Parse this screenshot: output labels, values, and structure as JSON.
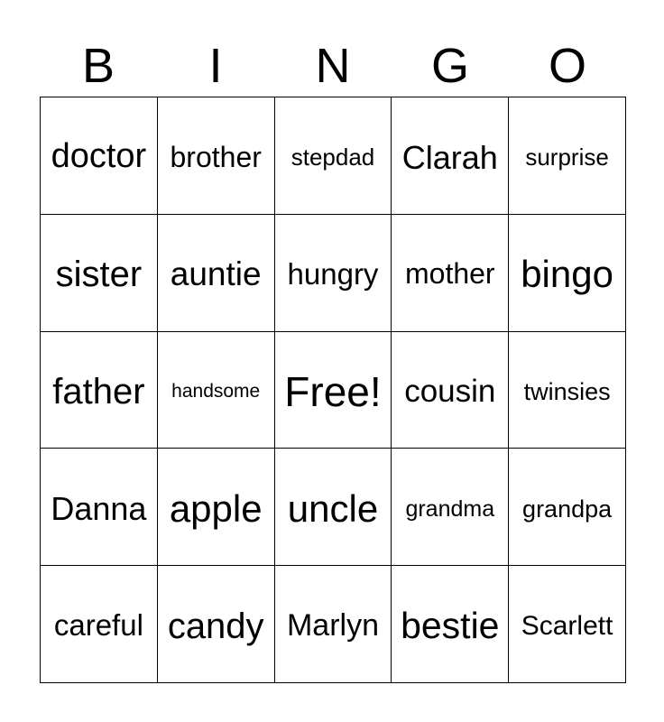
{
  "card": {
    "background_color": "#ffffff",
    "text_color": "#000000",
    "border_color": "#000000",
    "header": {
      "letters": [
        "B",
        "I",
        "N",
        "G",
        "O"
      ]
    },
    "free_space": {
      "label": "Free!",
      "row": 2,
      "column": 2
    },
    "columns": [
      "B",
      "I",
      "N",
      "G",
      "O"
    ],
    "rows": [
      {
        "cells": [
          {
            "text": "doctor",
            "font_size": 38
          },
          {
            "text": "brother",
            "font_size": 32
          },
          {
            "text": "stepdad",
            "font_size": 26
          },
          {
            "text": "Clarah",
            "font_size": 36
          },
          {
            "text": "surprise",
            "font_size": 26
          }
        ]
      },
      {
        "cells": [
          {
            "text": "sister",
            "font_size": 40
          },
          {
            "text": "auntie",
            "font_size": 37
          },
          {
            "text": "hungry",
            "font_size": 33
          },
          {
            "text": "mother",
            "font_size": 32
          },
          {
            "text": "bingo",
            "font_size": 42
          }
        ]
      },
      {
        "cells": [
          {
            "text": "father",
            "font_size": 40
          },
          {
            "text": "handsome",
            "font_size": 21
          },
          {
            "text": "Free!",
            "font_size": 46
          },
          {
            "text": "cousin",
            "font_size": 35
          },
          {
            "text": "twinsies",
            "font_size": 27
          }
        ]
      },
      {
        "cells": [
          {
            "text": "Danna",
            "font_size": 36
          },
          {
            "text": "apple",
            "font_size": 42
          },
          {
            "text": "uncle",
            "font_size": 42
          },
          {
            "text": "grandma",
            "font_size": 25
          },
          {
            "text": "grandpa",
            "font_size": 27
          }
        ]
      },
      {
        "cells": [
          {
            "text": "careful",
            "font_size": 33
          },
          {
            "text": "candy",
            "font_size": 40
          },
          {
            "text": "Marlyn",
            "font_size": 34
          },
          {
            "text": "bestie",
            "font_size": 41
          },
          {
            "text": "Scarlett",
            "font_size": 30
          }
        ]
      }
    ]
  }
}
